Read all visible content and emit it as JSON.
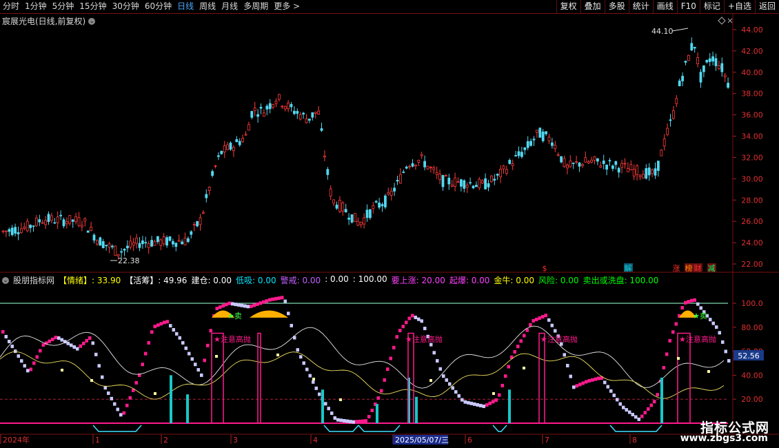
{
  "toolbar": {
    "periods": [
      "分时",
      "1分钟",
      "5分钟",
      "15分钟",
      "30分钟",
      "60分钟",
      "日线",
      "周线",
      "月线",
      "多周期",
      "更多 >"
    ],
    "active_period": "日线",
    "right_buttons": [
      "复权",
      "叠加",
      "多股",
      "统计",
      "画线",
      "F10",
      "标记",
      "+自选",
      "返回"
    ]
  },
  "main_chart": {
    "stock_title": "宸展光电(日线,前复权)",
    "y_ticks": [
      "44.00",
      "42.00",
      "40.00",
      "38.00",
      "36.00",
      "34.00",
      "32.00",
      "30.00",
      "28.00",
      "26.00",
      "24.00",
      "22.00"
    ],
    "high_label": "44.10",
    "low_label": "22.38",
    "event_markers": [
      "$",
      "解",
      "涨",
      "榜",
      "财",
      "减"
    ]
  },
  "indicator": {
    "name": "股朋指标网",
    "values": [
      {
        "label": "【情绪】:",
        "value": "33.90",
        "color": "#ffff00"
      },
      {
        "label": "【活筹】:",
        "value": "49.96",
        "color": "#ffffff"
      },
      {
        "label": "建仓:",
        "value": "0.00",
        "color": "#ffffff"
      },
      {
        "label": "低吸:",
        "value": "0.00",
        "color": "#00e5ff"
      },
      {
        "label": "警戒:",
        "value": "0.00",
        "color": "#c060ff"
      },
      {
        "label": ":",
        "value": "0.00",
        "color": "#ffffff"
      },
      {
        "label": ":",
        "value": "100.00",
        "color": "#ffffff"
      },
      {
        "label": "要上涨:",
        "value": "20.00",
        "color": "#ff40ff"
      },
      {
        "label": "起爆:",
        "value": "0.00",
        "color": "#ff40ff"
      },
      {
        "label": "金牛:",
        "value": "0.00",
        "color": "#ffff00"
      },
      {
        "label": "风险:",
        "value": "0.00",
        "color": "#00ff00"
      },
      {
        "label": "卖出或洗盘:",
        "value": "100.00",
        "color": "#00ff00"
      }
    ],
    "y_ticks": [
      "100.0",
      "80.00",
      "60.00",
      "40.00",
      "20.00"
    ],
    "current_value": "52.56",
    "annotations": [
      "注意高抛",
      "卖"
    ]
  },
  "x_axis": {
    "labels": [
      "2024年",
      "1",
      "2",
      "3",
      "4",
      "2025/05/07/三",
      "6",
      "7",
      "8"
    ]
  },
  "watermark": {
    "line1": "指标公式网",
    "line2": "www.zbgs3.com"
  },
  "colors": {
    "up": "#ff3b3b",
    "down": "#52d8f0",
    "pink": "#ff1a8c",
    "lavender": "#c8c8ff",
    "cyan": "#18c8c8",
    "gold": "#ffb000"
  }
}
